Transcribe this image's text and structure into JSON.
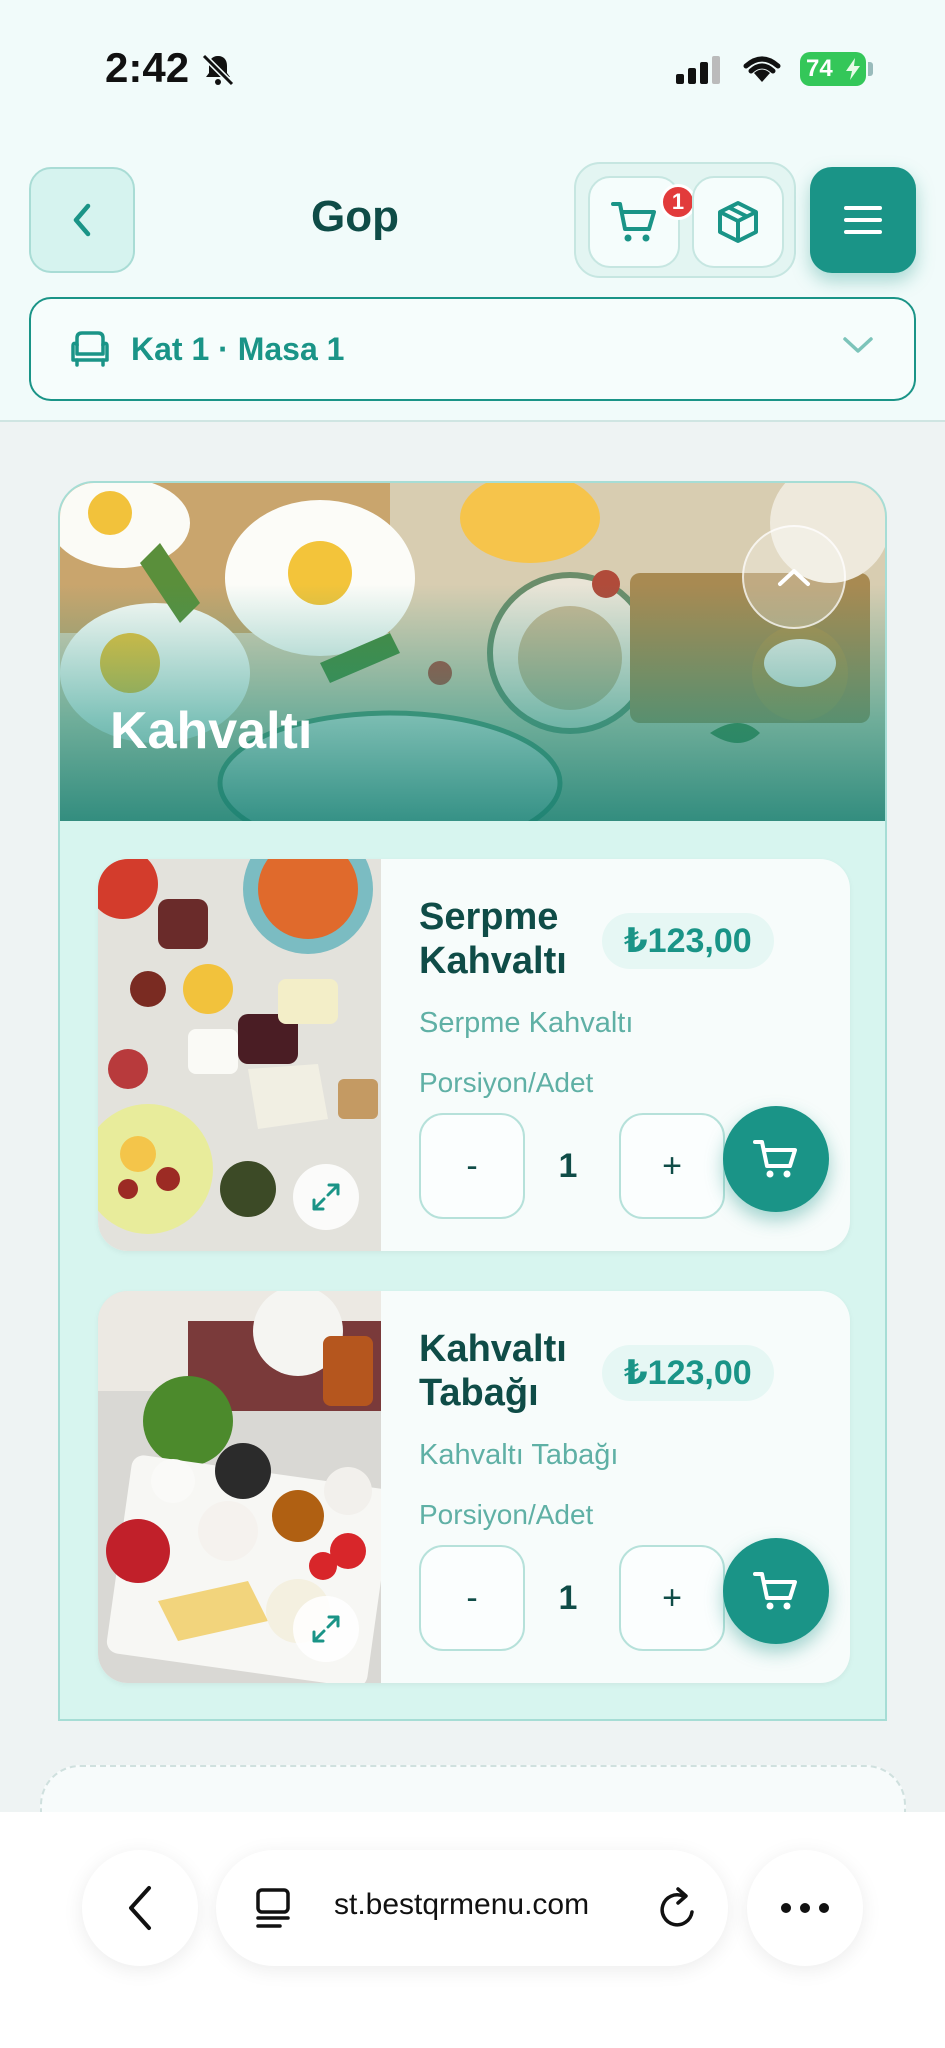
{
  "status": {
    "time": "2:42",
    "battery": "74"
  },
  "header": {
    "title": "Gop",
    "cart_count": "1",
    "table_label": "Kat 1 · Masa 1"
  },
  "category": {
    "title": "Kahvaltı"
  },
  "products": [
    {
      "name": "Serpme Kahvaltı",
      "price": "₺123,00",
      "description": "Serpme Kahvaltı",
      "portion_label": "Porsiyon/Adet",
      "quantity": "1",
      "minus": "-",
      "plus": "+"
    },
    {
      "name": "Kahvaltı Tabağı",
      "price": "₺123,00",
      "description": "Kahvaltı Tabağı",
      "portion_label": "Porsiyon/Adet",
      "quantity": "1",
      "minus": "-",
      "plus": "+"
    }
  ],
  "browser": {
    "url": "st.bestqrmenu.com"
  },
  "colors": {
    "accent": "#1a9487",
    "dark_text": "#0f4c47",
    "badge": "#e23b3b"
  }
}
